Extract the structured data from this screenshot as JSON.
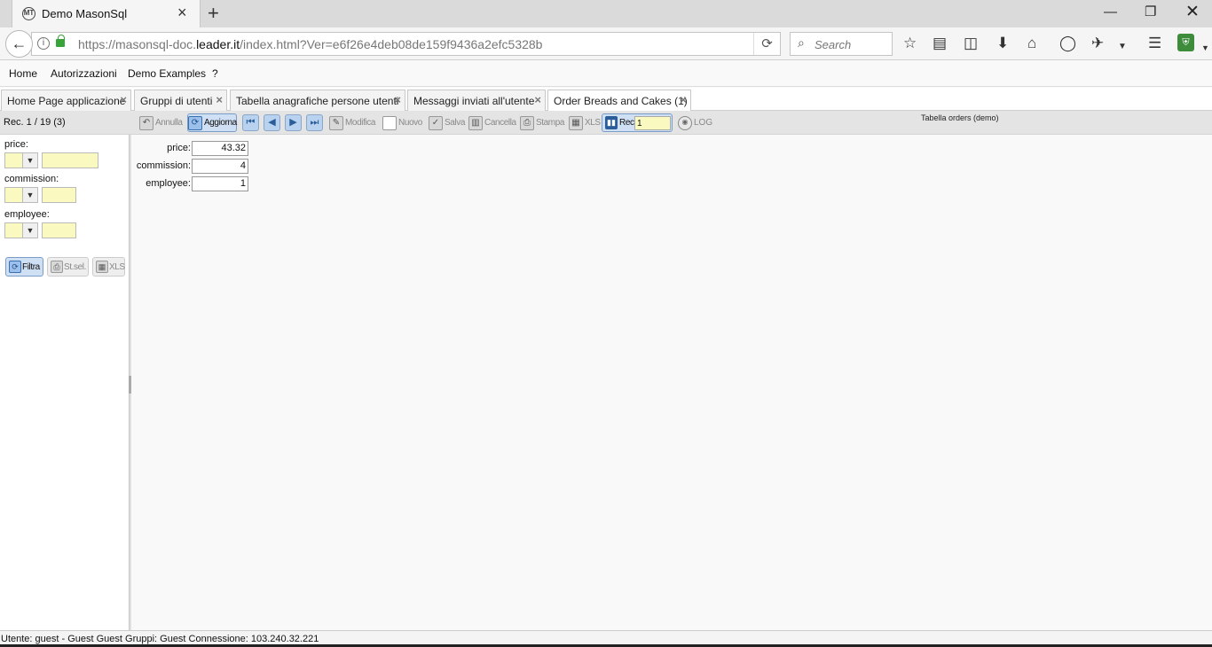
{
  "browser": {
    "tab_title": "Demo MasonSql",
    "favicon_text": "MT",
    "url_prefix": "https://masonsql-doc.",
    "url_domain": "leader.it",
    "url_suffix": "/index.html?Ver=e6f26e4deb08de159f9436a2efc5328b",
    "search_placeholder": "Search"
  },
  "menu": [
    "Home",
    "Autorizzazioni",
    "Demo Examples",
    "?"
  ],
  "app_tabs": [
    {
      "label": "Home Page applicazione",
      "active": false
    },
    {
      "label": "Gruppi di utenti",
      "active": false
    },
    {
      "label": "Tabella anagrafiche persone utenti",
      "active": false
    },
    {
      "label": "Messaggi inviati all'utente",
      "active": false
    },
    {
      "label": "Order Breads and Cakes (1)",
      "active": true
    }
  ],
  "toolbar": {
    "record_count": "Rec. 1 / 19 (3)",
    "annulla": "Annulla",
    "aggiorna": "Aggiorna",
    "modifica": "Modifica",
    "nuovo": "Nuovo",
    "salva": "Salva",
    "cancella": "Cancella",
    "stampa": "Stampa",
    "xls": "XLS",
    "rec_label": "Rec.",
    "rec_value": "1",
    "log": "LOG",
    "table_title": "Tabella orders (demo)"
  },
  "filters": {
    "fields": [
      {
        "label": "price:"
      },
      {
        "label": "commission:"
      },
      {
        "label": "employee:"
      }
    ],
    "filtra": "Filtra",
    "stsel": "St.sel.",
    "xls": "XLS"
  },
  "record": {
    "fields": [
      {
        "label": "price:",
        "value": "43.32"
      },
      {
        "label": "commission:",
        "value": "4"
      },
      {
        "label": "employee:",
        "value": "1"
      }
    ]
  },
  "status": "Utente: guest - Guest Guest Gruppi: Guest Connessione: 103.240.32.221"
}
